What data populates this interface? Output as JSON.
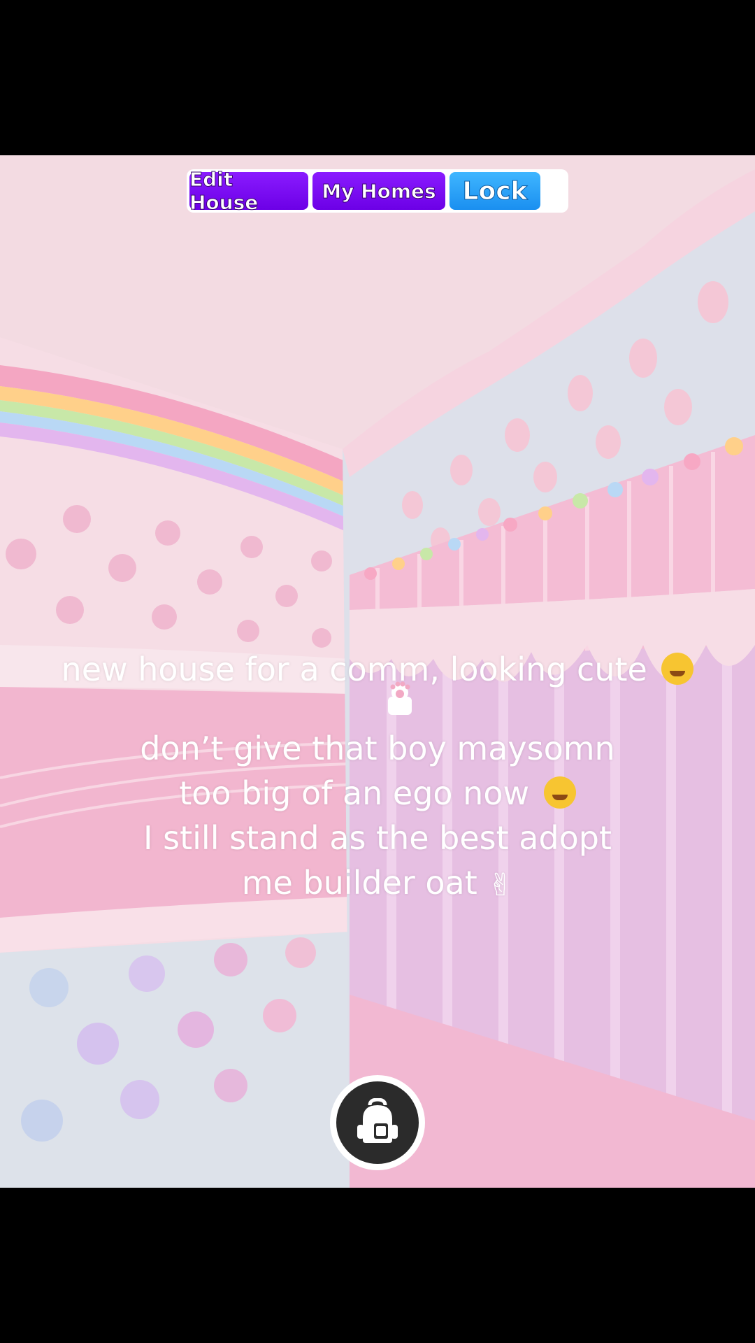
{
  "toolbar": {
    "edit_house_label": "Edit House",
    "my_homes_label": "My Homes",
    "lock_label": "Lock"
  },
  "caption": {
    "line1": "new house for a comm, looking cute",
    "line2": "don’t give that boy maysomn",
    "line3": "too big of an ego now",
    "line4": "I still stand as the best adopt",
    "line5": "me builder oat"
  },
  "icons": {
    "emoji_line1": "face-with-hand-over-mouth",
    "paw": "paw-icon",
    "emoji_line3": "cat-tears-of-joy",
    "emoji_line5": "victory-hand",
    "backpack": "backpack-icon"
  },
  "colors": {
    "edit_button": "#7a10f5",
    "lock_button": "#2ba3f8",
    "wall_pink": "#f3c4d6",
    "wall_blue": "#dde0ea"
  }
}
